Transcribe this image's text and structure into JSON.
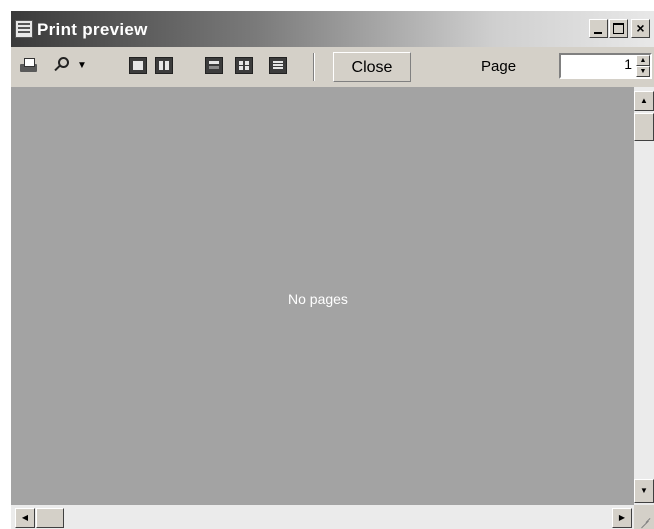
{
  "window": {
    "title": "Print preview",
    "icon": "print-preview-app-icon",
    "controls": [
      "minimize-icon",
      "maximize-icon",
      "close-icon"
    ]
  },
  "toolbar": {
    "icons": [
      "printer-icon",
      "magnifier-icon",
      "chevron-down-icon",
      "one-page-icon",
      "two-pages-icon",
      "three-pages-icon",
      "four-pages-icon",
      "six-pages-icon"
    ],
    "close_label": "Close",
    "page_label": "Page",
    "page_value": "1",
    "spin_up_glyph": "▲",
    "spin_down_glyph": "▼"
  },
  "preview": {
    "message": "No pages",
    "background": "#a3a3a3"
  },
  "scrollbars": {
    "up_glyph": "▲",
    "down_glyph": "▼",
    "left_glyph": "◀",
    "right_glyph": "▶"
  }
}
